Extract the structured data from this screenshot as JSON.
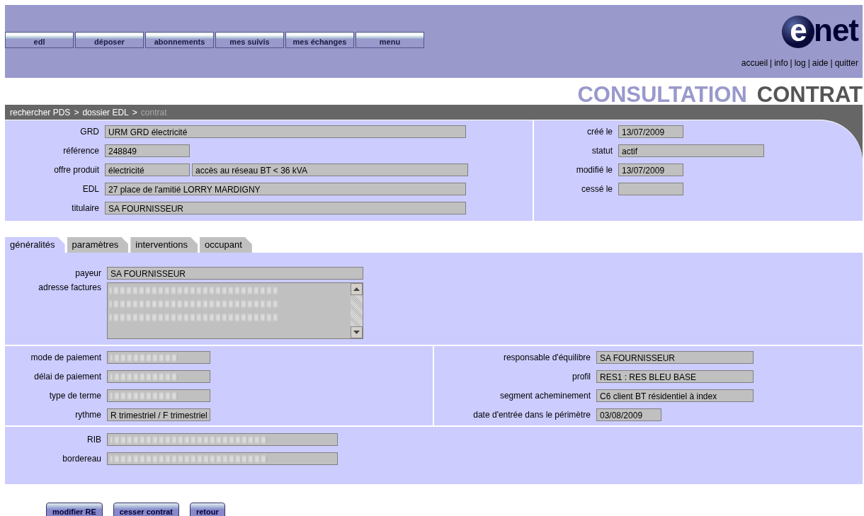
{
  "header": {
    "nav_buttons": [
      "edl",
      "déposer",
      "abonnements",
      "mes suivis",
      "mes échanges",
      "menu"
    ],
    "logo": "enet",
    "links": [
      "accueil",
      "info",
      "log",
      "aide",
      "quitter"
    ],
    "link_separator": "|"
  },
  "page_title": [
    {
      "text": "CONSULTATION",
      "kind": "light"
    },
    {
      "text": "CONTRAT",
      "kind": "dark"
    }
  ],
  "breadcrumb": {
    "separator": ">",
    "items": [
      {
        "label": "rechercher PDS",
        "current": false
      },
      {
        "label": "dossier EDL",
        "current": false
      },
      {
        "label": "contrat",
        "current": true
      }
    ]
  },
  "summary": {
    "left": [
      {
        "label": "GRD",
        "values": [
          "URM GRD électricité"
        ]
      },
      {
        "label": "référence",
        "values": [
          "248849"
        ]
      },
      {
        "label": "offre produit",
        "values": [
          "électricité",
          "accès au réseau BT < 36 kVA"
        ]
      },
      {
        "label": "EDL",
        "values": [
          "27 place de l'amitié LORRY MARDIGNY"
        ]
      },
      {
        "label": "titulaire",
        "values": [
          "SA FOURNISSEUR"
        ]
      }
    ],
    "right": [
      {
        "label": "créé le",
        "values": [
          "13/07/2009"
        ]
      },
      {
        "label": "statut",
        "values": [
          "actif"
        ]
      },
      {
        "label": "modifié le",
        "values": [
          "13/07/2009"
        ]
      },
      {
        "label": "cessé le"
      }
    ]
  },
  "tabs": [
    {
      "label": "généralités",
      "selected": true
    },
    {
      "label": "paramètres",
      "selected": false
    },
    {
      "label": "interventions",
      "selected": false
    },
    {
      "label": "occupant",
      "selected": false
    }
  ],
  "general": {
    "payer": [
      {
        "label": "payeur",
        "kind": "field",
        "value": "SA FOURNISSEUR",
        "blurred": false
      },
      {
        "label": "adresse factures",
        "kind": "textarea",
        "blurred": true
      }
    ],
    "payment": [
      {
        "label": "mode de paiement",
        "kind": "field",
        "blurred": true
      },
      {
        "label": "délai de paiement",
        "kind": "field",
        "blurred": true
      },
      {
        "label": "type de terme",
        "kind": "field",
        "blurred": true
      },
      {
        "label": "rythme",
        "kind": "field",
        "value": "R trimestriel / F trimestriel",
        "blurred": false
      }
    ],
    "balance": [
      {
        "label": "responsable d'équilibre",
        "kind": "field",
        "value": "SA FOURNISSEUR",
        "blurred": false
      },
      {
        "label": "profil",
        "kind": "field",
        "value": "RES1 : RES BLEU BASE",
        "blurred": false
      },
      {
        "label": "segment acheminement",
        "kind": "field",
        "value": "C6 client BT résidentiel à index",
        "blurred": false
      },
      {
        "label": "date d'entrée dans le périmètre",
        "kind": "field",
        "value": "03/08/2009",
        "blurred": false
      }
    ],
    "bank": [
      {
        "label": "RIB",
        "kind": "field",
        "blurred": true
      },
      {
        "label": "bordereau",
        "kind": "field",
        "blurred": true
      }
    ]
  },
  "actions": [
    "modifier RE",
    "cesser contrat",
    "retour"
  ]
}
